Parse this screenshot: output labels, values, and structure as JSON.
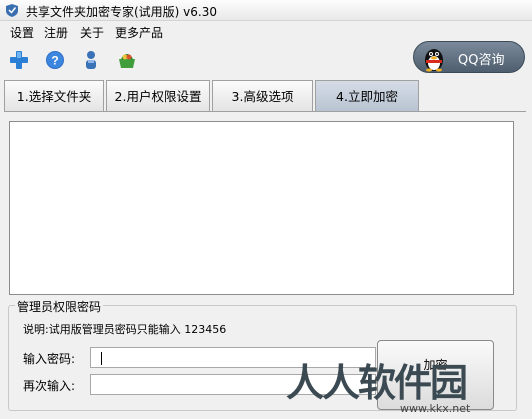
{
  "window": {
    "title": "共享文件夹加密专家(试用版) v6.30"
  },
  "menu": [
    "设置",
    "注册",
    "关于",
    "更多产品"
  ],
  "toolbar": {
    "icons": [
      "add-icon",
      "help-icon",
      "user-icon",
      "basket-icon"
    ]
  },
  "qq": {
    "label": "QQ咨询"
  },
  "tabs": [
    "1.选择文件夹",
    "2.用户权限设置",
    "3.高级选项",
    "4.立即加密"
  ],
  "active_tab": 3,
  "admin": {
    "group_title": "管理员权限密码",
    "note": "说明:试用版管理员密码只能输入  123456",
    "password_label": "输入密码:",
    "password_value": "",
    "confirm_label": "再次输入:",
    "confirm_value": "",
    "encrypt_button": "加密"
  },
  "watermark": {
    "text": "人人软件园",
    "url": "www.kkx.net"
  },
  "colors": {
    "qq_button": "#5d6c7b",
    "active_tab": "#c5cfdc"
  }
}
